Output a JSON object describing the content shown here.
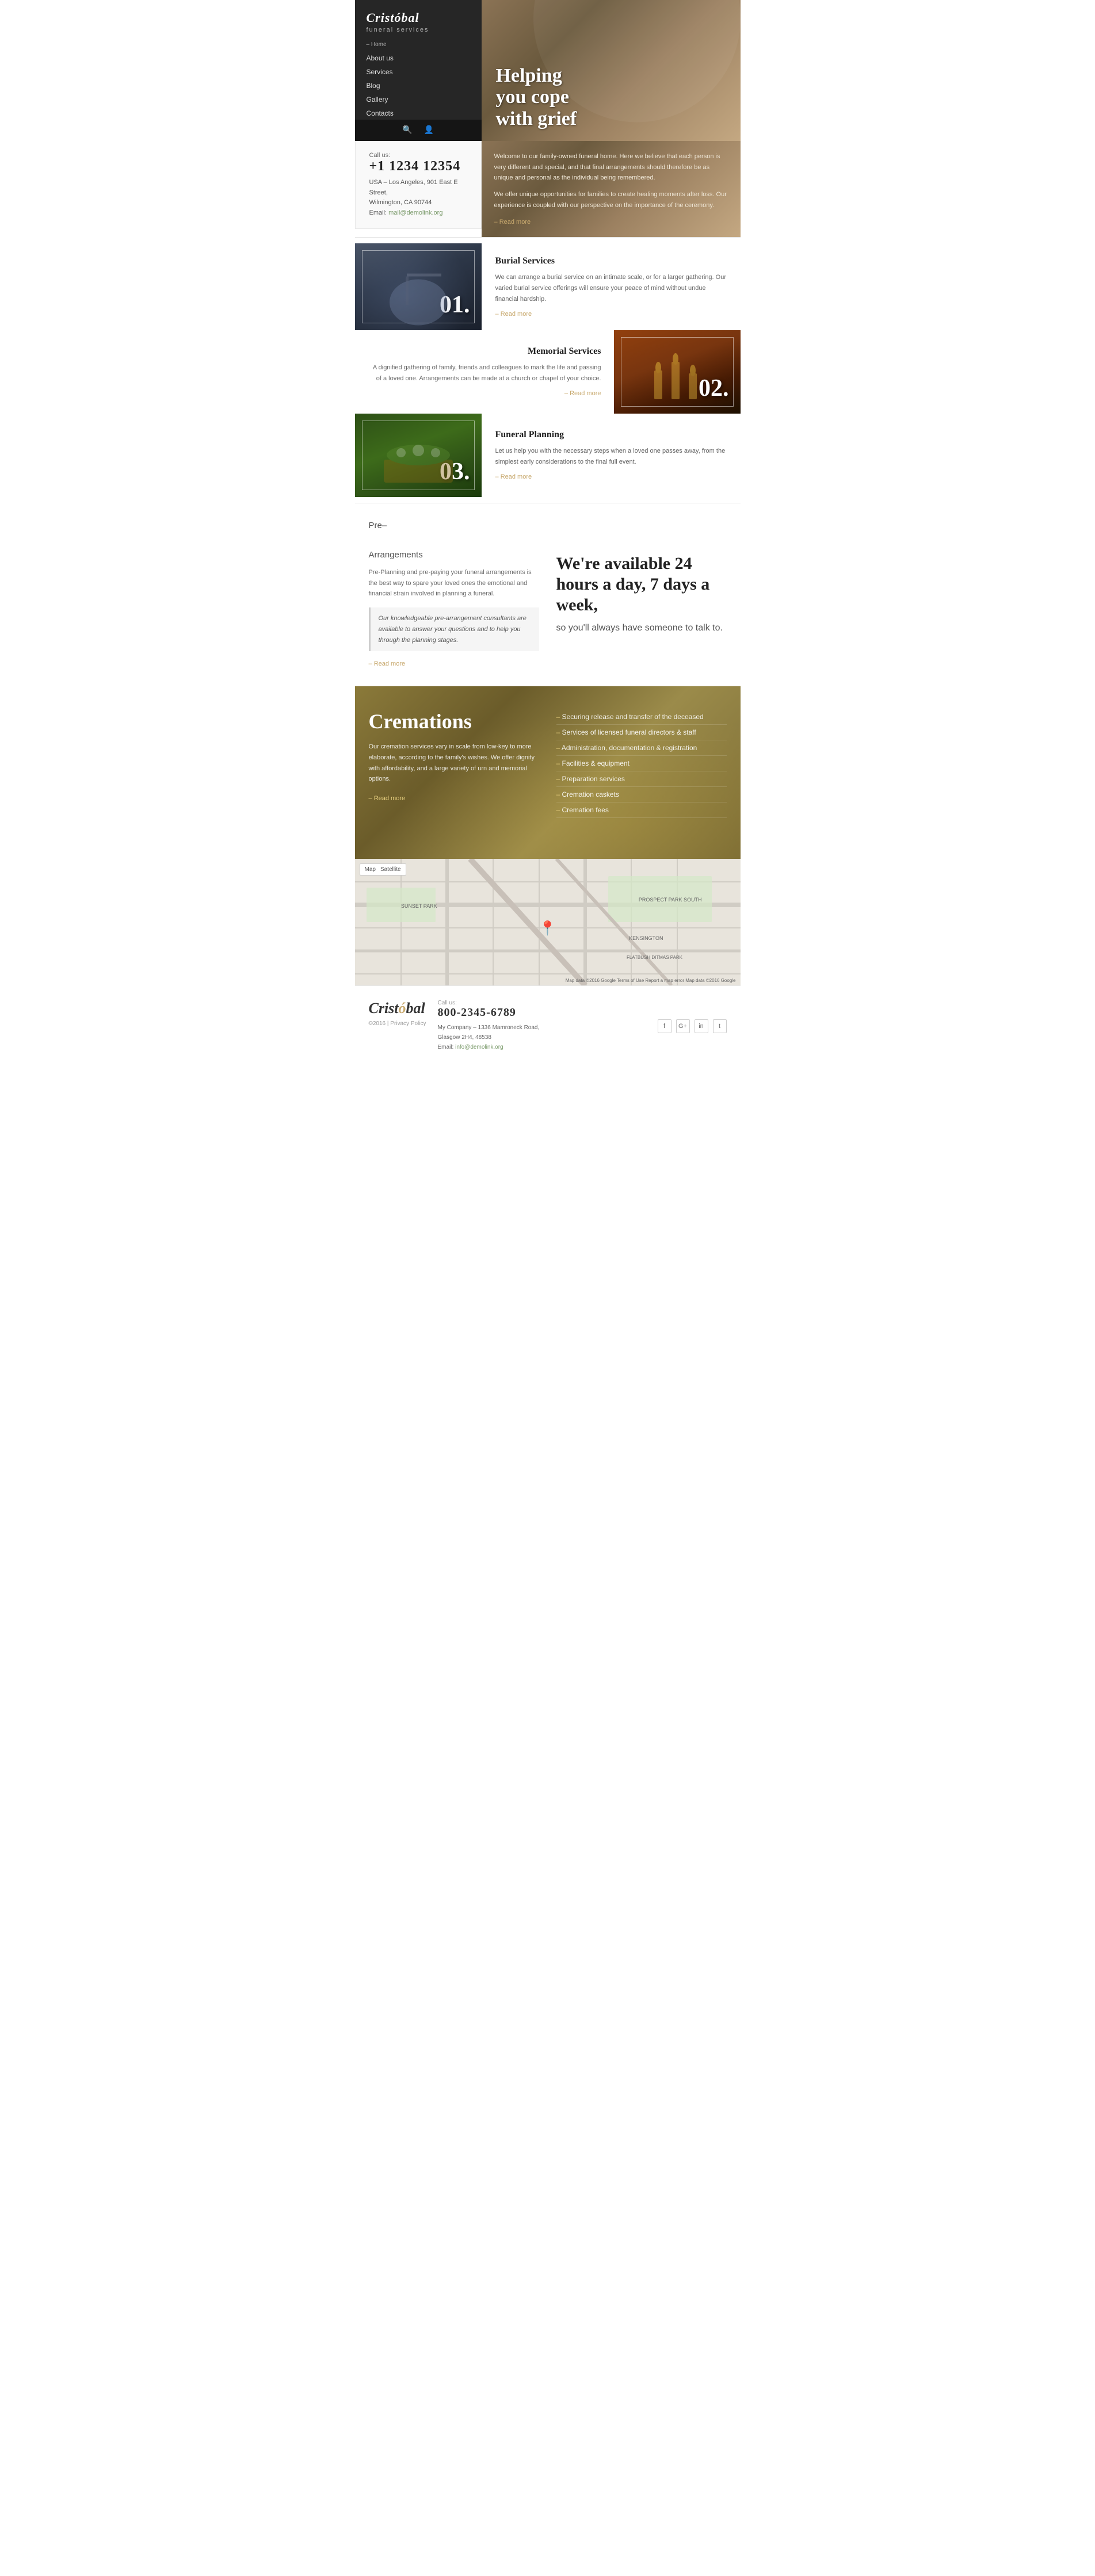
{
  "brand": {
    "name_part1": "Crist",
    "name_accent": "ó",
    "name_part2": "bal",
    "tagline": "funeral services"
  },
  "nav": {
    "home": "– Home",
    "items": [
      {
        "label": "About us",
        "href": "#"
      },
      {
        "label": "Services",
        "href": "#"
      },
      {
        "label": "Blog",
        "href": "#"
      },
      {
        "label": "Gallery",
        "href": "#"
      },
      {
        "label": "Contacts",
        "href": "#"
      }
    ]
  },
  "hero": {
    "headline_line1": "Helping",
    "headline_line2": "you cope",
    "headline_line3": "with grief",
    "para1": "Welcome to our family-owned funeral home. Here we believe that each person is very different and special, and that final arrangements should therefore be as unique and personal as the individual being remembered.",
    "para2": "We offer unique opportunities for families to create healing moments after loss. Our experience is coupled with our perspective on the importance of the ceremony.",
    "read_more": "Read more"
  },
  "info": {
    "call_label": "Call us:",
    "phone": "+1 1234 12354",
    "address_line1": "USA – Los Angeles, 901 East E Street,",
    "address_line2": "Wilmington, CA 90744",
    "email_label": "Email:",
    "email": "mail@demolink.org"
  },
  "services": [
    {
      "number": "01",
      "title": "Burial Services",
      "description": "We can arrange a burial service on an intimate scale, or for a larger gathering. Our varied burial service offerings will ensure your peace of mind without undue financial hardship.",
      "read_more": "Read more",
      "image_class": "bg-flag",
      "position": "right"
    },
    {
      "number": "02",
      "title": "Memorial Services",
      "description": "A dignified gathering of family, friends and colleagues to mark the life and passing of a loved one. Arrangements can be made at a church or chapel of your choice.",
      "read_more": "Read more",
      "image_class": "bg-candles",
      "position": "left"
    },
    {
      "number": "03",
      "title": "Funeral Planning",
      "description": "Let us help you with the necessary steps when a loved one passes away, from the simplest early considerations to the final full event.",
      "read_more": "Read more",
      "image_class": "bg-flowers",
      "position": "right"
    }
  ],
  "pre_arrange": {
    "title_line1": "Pre–",
    "title_line2": "Arrangements",
    "para1": "Pre-Planning and pre-paying your funeral arrangements is the best way to spare your loved ones the emotional and financial strain involved in planning a funeral.",
    "quote": "Our knowledgeable pre-arrangement consultants are available to answer your questions and to help you through the planning stages.",
    "read_more": "Read more"
  },
  "availability": {
    "headline": "We're available 24 hours a day, 7 days a week,",
    "subtext": "so you'll always have someone to talk to."
  },
  "cremations": {
    "title": "Cremations",
    "description": "Our cremation services vary in scale from low-key to more elaborate, according to the family's wishes. We offer dignity with affordability, and a large variety of urn and memorial options.",
    "read_more": "Read more",
    "list": [
      "Securing release and transfer of the deceased",
      "Services of licensed funeral directors & staff",
      "Administration, documentation & registration",
      "Facilities & equipment",
      "Preparation services",
      "Cremation caskets",
      "Cremation fees"
    ]
  },
  "map": {
    "controls": [
      "Map",
      "Satellite"
    ],
    "pin_label": "📍",
    "neighborhoods": [
      {
        "name": "SUNSET PARK",
        "class": "nb-sunset"
      },
      {
        "name": "PROSPECT PARK SOUTH",
        "class": "nb-prospect"
      },
      {
        "name": "KENSINGTON",
        "class": "nb-kensington"
      },
      {
        "name": "FLATBUSH DITMAS PARK",
        "class": "nb-flatbush"
      }
    ],
    "attribution": "Map data ©2016 Google  Terms of Use  Report a map error  Map data ©2016 Google"
  },
  "footer": {
    "logo_part1": "Crist",
    "logo_accent": "ó",
    "logo_part2": "bal",
    "copyright": "©2016 | Privacy Policy",
    "call_label": "Call us:",
    "phone": "800-2345-6789",
    "address_line1": "My Company – 1336 Mamroneck Road,",
    "address_line2": "Glasgow 2H4, 48538",
    "email_label": "Email:",
    "email": "info@demolink.org",
    "social": [
      "f",
      "G+",
      "in",
      "𝕥"
    ]
  }
}
